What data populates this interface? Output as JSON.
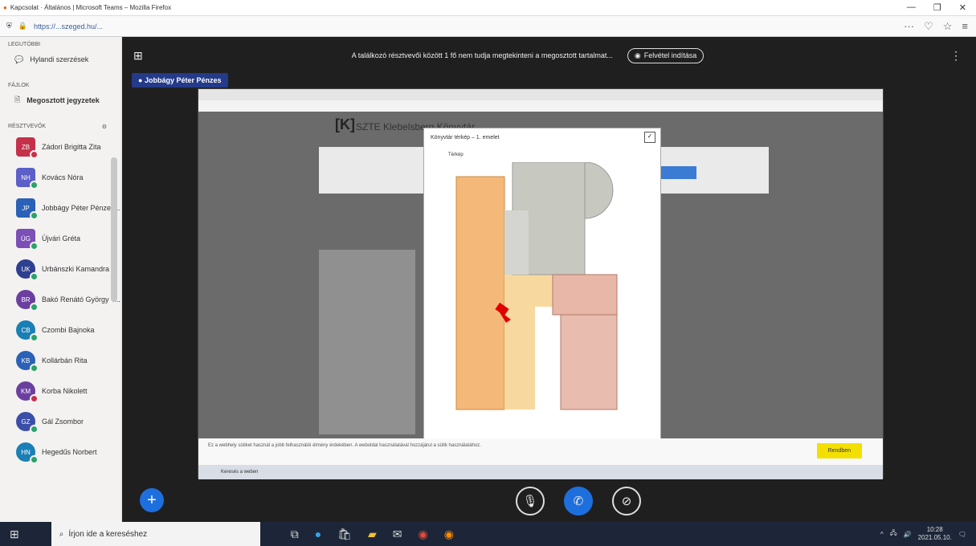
{
  "window": {
    "title": "Kapcsolat · Általános | Microsoft Teams – Mozilla Firefox",
    "minimize": "—",
    "maximize": "❐",
    "close": "✕"
  },
  "browser": {
    "url": "https://...szeged.hu/...",
    "actions": [
      "···",
      "♡",
      "☆",
      "≡"
    ]
  },
  "sidebar": {
    "section_recent": "Legutóbbi",
    "recent_item": "Hylandi szerzések",
    "section_files": "Fájlok",
    "files_item": "Megosztott jegyzetek",
    "section_people": "Résztvevők",
    "people": [
      {
        "initials": "ZB",
        "name": "Zádori Brigitta Zita",
        "color": "#c4314b",
        "shape": "square",
        "status": "#c4314b"
      },
      {
        "initials": "NH",
        "name": "Kovács Nóra",
        "color": "#5b5fc7",
        "shape": "square",
        "status": "#27a36b"
      },
      {
        "initials": "JP",
        "name": "Jobbágy Péter Pénzes...",
        "color": "#2b61b6",
        "shape": "square",
        "status": "#27a36b"
      },
      {
        "initials": "ÚG",
        "name": "Újvári Gréta",
        "color": "#7b4fb5",
        "shape": "square",
        "status": "#27a36b"
      },
      {
        "initials": "UK",
        "name": "Urbánszki Kamandra",
        "color": "#2d3f8f",
        "shape": "round",
        "status": "#27a36b"
      },
      {
        "initials": "BR",
        "name": "Bakó Renátó György T...",
        "color": "#6b3fa0",
        "shape": "round",
        "status": "#27a36b"
      },
      {
        "initials": "CB",
        "name": "Czombi Bajnoka",
        "color": "#1a7fb5",
        "shape": "round",
        "status": "#27a36b"
      },
      {
        "initials": "KB",
        "name": "Kollárbán Rita",
        "color": "#2b61b6",
        "shape": "round",
        "status": "#27a36b"
      },
      {
        "initials": "KM",
        "name": "Korba Nikolett",
        "color": "#6b3fa0",
        "shape": "round",
        "status": "#c4314b"
      },
      {
        "initials": "GZ",
        "name": "Gál Zsombor",
        "color": "#3b4ea8",
        "shape": "round",
        "status": "#27a36b"
      },
      {
        "initials": "HN",
        "name": "Hegedűs Norbert",
        "color": "#1a7fb5",
        "shape": "round",
        "status": "#27a36b"
      }
    ]
  },
  "meeting": {
    "banner": "A találkozó résztvevői között 1 fő nem tudja megtekinteni a megosztott tartalmat...",
    "recording": "Felvétel indítása",
    "presenter": "Jobbágy Péter Pénzes"
  },
  "shared_screen": {
    "page_title": "SZTE Klebelsberg Könyvtár",
    "modal_title": "Könyvtár térkép – 1. emelet",
    "modal_tab": "Térkép",
    "cookie_text": "Ez a webhely sütiket használ a jobb felhasználói élmény érdekében. A weboldal használatával hozzájárul a sütik használatához.",
    "accept_label": "Rendben",
    "inner_search": "Keresés a weben"
  },
  "taskbar": {
    "search_placeholder": "Írjon ide a kereséshez",
    "time": "10:28",
    "date": "2021.05.10."
  }
}
